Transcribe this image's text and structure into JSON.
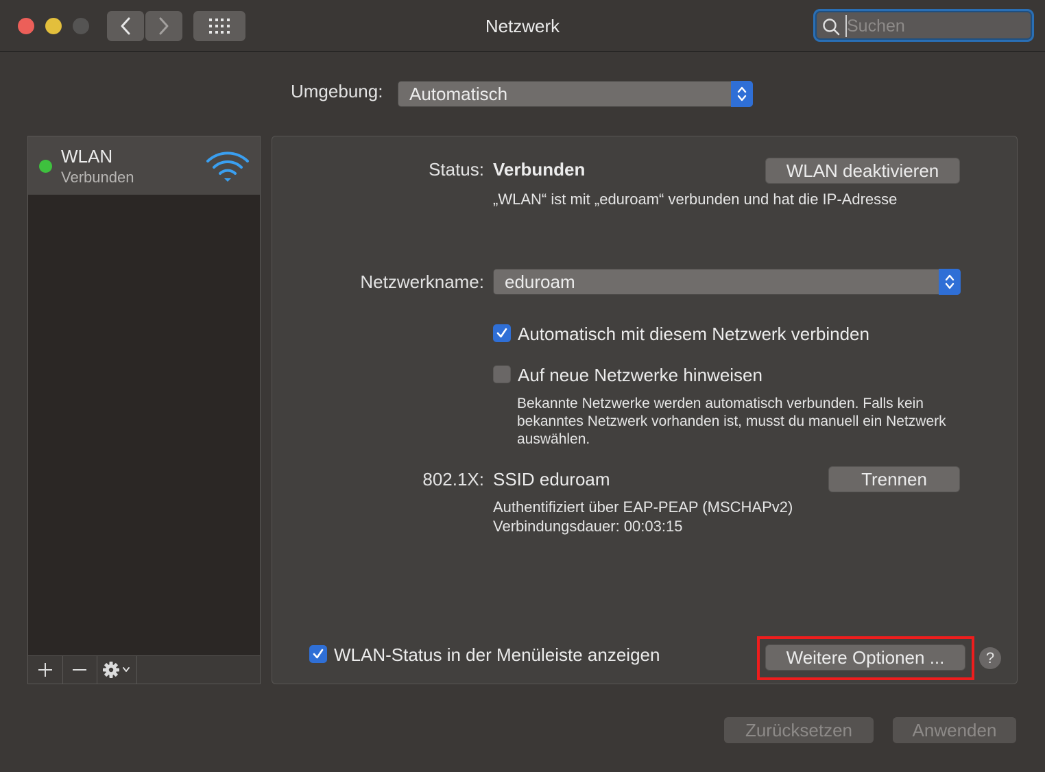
{
  "window": {
    "title": "Netzwerk",
    "search": {
      "placeholder": "Suchen"
    }
  },
  "location": {
    "label": "Umgebung:",
    "value": "Automatisch"
  },
  "sidebar": {
    "items": [
      {
        "name": "WLAN",
        "status": "Verbunden",
        "status_color": "#3ec13e",
        "icon": "wifi-icon"
      }
    ],
    "toolbar": {
      "add": "+",
      "remove": "−",
      "gear": "gear-icon"
    }
  },
  "detail": {
    "status_label": "Status:",
    "status_value": "Verbunden",
    "toggle_button": "WLAN deaktivieren",
    "status_description": "„WLAN“ ist mit „eduroam“ verbunden und hat die IP-Adresse",
    "network_name_label": "Netzwerkname:",
    "network_name_value": "eduroam",
    "auto_join": {
      "label": "Automatisch mit diesem Netzwerk verbinden",
      "checked": true
    },
    "ask_new": {
      "label": "Auf neue Netzwerke hinweisen",
      "checked": false
    },
    "ask_new_help": [
      "Bekannte Netzwerke werden automatisch verbunden. Falls kein",
      "bekanntes Netzwerk vorhanden ist, musst du manuell ein Netzwerk",
      "auswählen."
    ],
    "dot1x_label": "802.1X:",
    "dot1x_value": "SSID eduroam",
    "dot1x_button": "Trennen",
    "dot1x_auth": "Authentifiziert über EAP-PEAP (MSCHAPv2)",
    "dot1x_duration": "Verbindungsdauer: 00:03:15",
    "show_status": {
      "label": "WLAN-Status in der Menüleiste anzeigen",
      "checked": true
    },
    "advanced_button": "Weitere Optionen ...",
    "help": "?"
  },
  "footer": {
    "revert": "Zurücksetzen",
    "apply": "Anwenden"
  },
  "colors": {
    "accent": "#2f6fd6",
    "highlight": "#ee1d1d",
    "connected": "#3ec13e"
  }
}
